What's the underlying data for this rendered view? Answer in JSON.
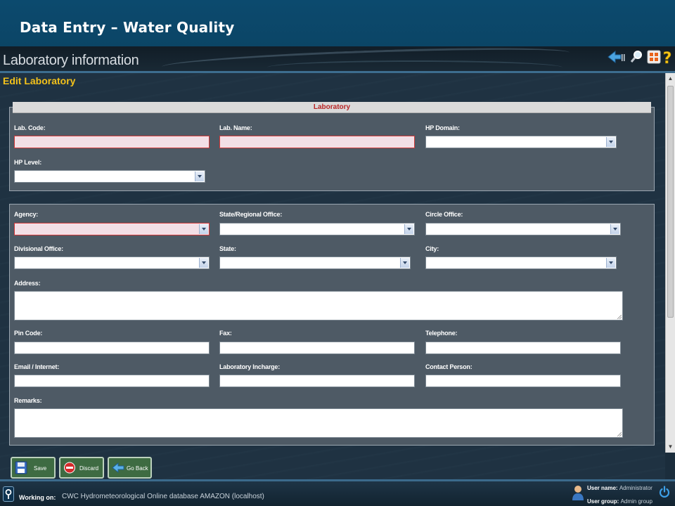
{
  "slide_title": "Data Entry – Water Quality",
  "app": {
    "title": "Laboratory information",
    "icons": {
      "back": "back-arrow-icon",
      "search": "magnifier-icon",
      "grid": "grid-menu-icon",
      "help": "help-icon"
    }
  },
  "form": {
    "title": "Edit Laboratory",
    "section_header": "Laboratory",
    "labels": {
      "lab_code": "Lab. Code:",
      "lab_name": "Lab. Name:",
      "hp_domain": "HP Domain:",
      "hp_level": "HP Level:",
      "agency": "Agency:",
      "state_regional_office": "State/Regional Office:",
      "circle_office": "Circle Office:",
      "divisional_office": "Divisional Office:",
      "state": "State:",
      "city": "City:",
      "address": "Address:",
      "pin_code": "Pin Code:",
      "fax": "Fax:",
      "telephone": "Telephone:",
      "email": "Email / Internet:",
      "lab_incharge": "Laboratory Incharge:",
      "contact_person": "Contact Person:",
      "remarks": "Remarks:"
    }
  },
  "buttons": {
    "save": "Save",
    "discard": "Discard",
    "go_back": "Go Back"
  },
  "status": {
    "working_on_label": "Working on:",
    "working_on_value": "CWC Hydrometeorological Online database AMAZON (localhost)",
    "user_name_label": "User name:",
    "user_name_value": "Administrator",
    "user_group_label": "User group:",
    "user_group_value": "Admin group"
  },
  "colors": {
    "title_band": "#0c4a6e",
    "form_title": "#f3c21b",
    "panel": "#4e5a65",
    "required_field": "#f3dfe6",
    "required_border": "#d23a3a",
    "button": "#3e6b42",
    "section_header_text": "#b82525"
  }
}
